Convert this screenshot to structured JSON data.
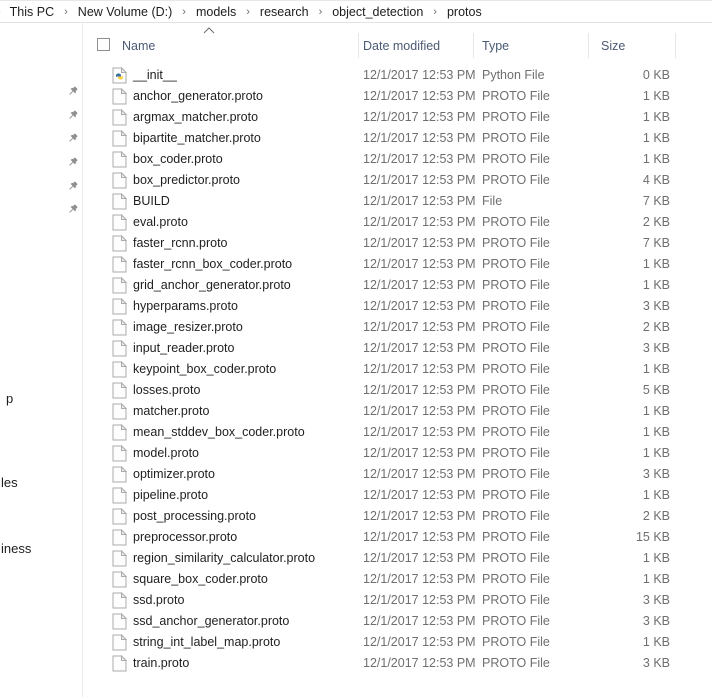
{
  "breadcrumb": {
    "leading_chevron": "›",
    "separator": "›",
    "items": [
      "This PC",
      "New Volume (D:)",
      "models",
      "research",
      "object_detection",
      "protos"
    ]
  },
  "nav_pane": {
    "pinned_item_count": 6,
    "pin_icon": "pushpin",
    "partial_labels": [
      "p",
      "les",
      "iness"
    ]
  },
  "file_list": {
    "select_all_checked": false,
    "sort": {
      "column": "Name",
      "direction": "ascending"
    },
    "columns": [
      {
        "label": "Name"
      },
      {
        "label": "Date modified"
      },
      {
        "label": "Type"
      },
      {
        "label": "Size"
      }
    ],
    "rows": [
      {
        "name": "__init__",
        "date": "12/1/2017 12:53 PM",
        "type": "Python File",
        "size": "0 KB",
        "icon": "python-file"
      },
      {
        "name": "anchor_generator.proto",
        "date": "12/1/2017 12:53 PM",
        "type": "PROTO File",
        "size": "1 KB",
        "icon": "file"
      },
      {
        "name": "argmax_matcher.proto",
        "date": "12/1/2017 12:53 PM",
        "type": "PROTO File",
        "size": "1 KB",
        "icon": "file"
      },
      {
        "name": "bipartite_matcher.proto",
        "date": "12/1/2017 12:53 PM",
        "type": "PROTO File",
        "size": "1 KB",
        "icon": "file"
      },
      {
        "name": "box_coder.proto",
        "date": "12/1/2017 12:53 PM",
        "type": "PROTO File",
        "size": "1 KB",
        "icon": "file"
      },
      {
        "name": "box_predictor.proto",
        "date": "12/1/2017 12:53 PM",
        "type": "PROTO File",
        "size": "4 KB",
        "icon": "file"
      },
      {
        "name": "BUILD",
        "date": "12/1/2017 12:53 PM",
        "type": "File",
        "size": "7 KB",
        "icon": "file"
      },
      {
        "name": "eval.proto",
        "date": "12/1/2017 12:53 PM",
        "type": "PROTO File",
        "size": "2 KB",
        "icon": "file"
      },
      {
        "name": "faster_rcnn.proto",
        "date": "12/1/2017 12:53 PM",
        "type": "PROTO File",
        "size": "7 KB",
        "icon": "file"
      },
      {
        "name": "faster_rcnn_box_coder.proto",
        "date": "12/1/2017 12:53 PM",
        "type": "PROTO File",
        "size": "1 KB",
        "icon": "file"
      },
      {
        "name": "grid_anchor_generator.proto",
        "date": "12/1/2017 12:53 PM",
        "type": "PROTO File",
        "size": "1 KB",
        "icon": "file"
      },
      {
        "name": "hyperparams.proto",
        "date": "12/1/2017 12:53 PM",
        "type": "PROTO File",
        "size": "3 KB",
        "icon": "file"
      },
      {
        "name": "image_resizer.proto",
        "date": "12/1/2017 12:53 PM",
        "type": "PROTO File",
        "size": "2 KB",
        "icon": "file"
      },
      {
        "name": "input_reader.proto",
        "date": "12/1/2017 12:53 PM",
        "type": "PROTO File",
        "size": "3 KB",
        "icon": "file"
      },
      {
        "name": "keypoint_box_coder.proto",
        "date": "12/1/2017 12:53 PM",
        "type": "PROTO File",
        "size": "1 KB",
        "icon": "file"
      },
      {
        "name": "losses.proto",
        "date": "12/1/2017 12:53 PM",
        "type": "PROTO File",
        "size": "5 KB",
        "icon": "file"
      },
      {
        "name": "matcher.proto",
        "date": "12/1/2017 12:53 PM",
        "type": "PROTO File",
        "size": "1 KB",
        "icon": "file"
      },
      {
        "name": "mean_stddev_box_coder.proto",
        "date": "12/1/2017 12:53 PM",
        "type": "PROTO File",
        "size": "1 KB",
        "icon": "file"
      },
      {
        "name": "model.proto",
        "date": "12/1/2017 12:53 PM",
        "type": "PROTO File",
        "size": "1 KB",
        "icon": "file"
      },
      {
        "name": "optimizer.proto",
        "date": "12/1/2017 12:53 PM",
        "type": "PROTO File",
        "size": "3 KB",
        "icon": "file"
      },
      {
        "name": "pipeline.proto",
        "date": "12/1/2017 12:53 PM",
        "type": "PROTO File",
        "size": "1 KB",
        "icon": "file"
      },
      {
        "name": "post_processing.proto",
        "date": "12/1/2017 12:53 PM",
        "type": "PROTO File",
        "size": "2 KB",
        "icon": "file"
      },
      {
        "name": "preprocessor.proto",
        "date": "12/1/2017 12:53 PM",
        "type": "PROTO File",
        "size": "15 KB",
        "icon": "file"
      },
      {
        "name": "region_similarity_calculator.proto",
        "date": "12/1/2017 12:53 PM",
        "type": "PROTO File",
        "size": "1 KB",
        "icon": "file"
      },
      {
        "name": "square_box_coder.proto",
        "date": "12/1/2017 12:53 PM",
        "type": "PROTO File",
        "size": "1 KB",
        "icon": "file"
      },
      {
        "name": "ssd.proto",
        "date": "12/1/2017 12:53 PM",
        "type": "PROTO File",
        "size": "3 KB",
        "icon": "file"
      },
      {
        "name": "ssd_anchor_generator.proto",
        "date": "12/1/2017 12:53 PM",
        "type": "PROTO File",
        "size": "3 KB",
        "icon": "file"
      },
      {
        "name": "string_int_label_map.proto",
        "date": "12/1/2017 12:53 PM",
        "type": "PROTO File",
        "size": "1 KB",
        "icon": "file"
      },
      {
        "name": "train.proto",
        "date": "12/1/2017 12:53 PM",
        "type": "PROTO File",
        "size": "3 KB",
        "icon": "file"
      }
    ]
  },
  "colors": {
    "header_text": "#4b5b73",
    "primary_text": "#1f1f1f",
    "secondary_text": "#6f6f6f",
    "border": "#e6e6e6",
    "pin_gray": "#8c8c8c",
    "python_blue": "#3871a1",
    "python_yellow": "#ffd040"
  }
}
